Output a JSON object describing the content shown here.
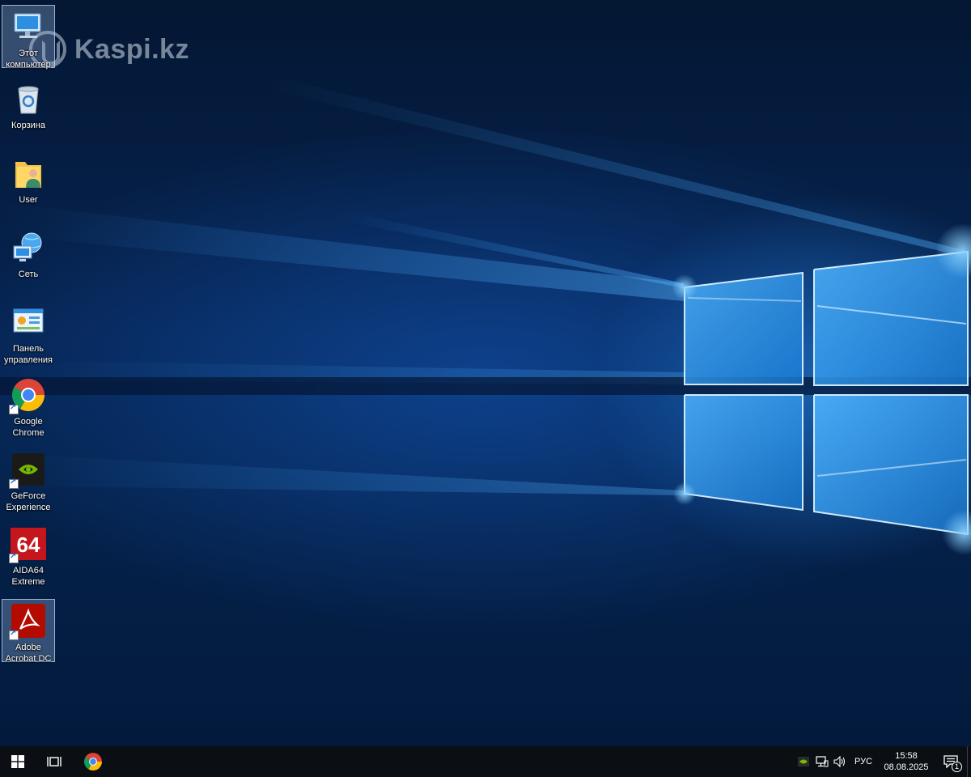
{
  "watermark": {
    "text": "Kaspi.kz"
  },
  "desktop_icons": [
    {
      "label": "Этот компьютер",
      "icon": "this-pc-icon",
      "selected": true
    },
    {
      "label": "Корзина",
      "icon": "recycle-bin-icon",
      "selected": false
    },
    {
      "label": "User",
      "icon": "user-folder-icon",
      "selected": false
    },
    {
      "label": "Сеть",
      "icon": "network-icon",
      "selected": false
    },
    {
      "label": "Панель управления",
      "icon": "control-panel-icon",
      "selected": false
    },
    {
      "label": "Google Chrome",
      "icon": "chrome-icon",
      "shortcut": true,
      "selected": false
    },
    {
      "label": "GeForce Experience",
      "icon": "nvidia-icon",
      "shortcut": true,
      "selected": false
    },
    {
      "label": "AIDA64 Extreme",
      "icon": "aida64-icon",
      "badge": "64",
      "shortcut": true,
      "selected": false
    },
    {
      "label": "Adobe Acrobat DC",
      "icon": "acrobat-icon",
      "shortcut": true,
      "selected": true
    }
  ],
  "taskbar": {
    "start": {
      "icon": "windows-start-icon"
    },
    "task_view": {
      "icon": "task-view-icon"
    },
    "pinned": [
      {
        "icon": "chrome-icon",
        "name": "Google Chrome"
      }
    ],
    "tray": {
      "nvidia": {
        "icon": "nvidia-tray-icon"
      },
      "network": {
        "icon": "network-tray-icon"
      },
      "volume": {
        "icon": "volume-icon"
      },
      "language": "РУС",
      "time": "15:58",
      "date": "08.08.2025",
      "notifications": {
        "icon": "action-center-icon",
        "count": "1"
      }
    }
  },
  "colors": {
    "taskbar": "#0b0f14",
    "wallpaper_dark": "#041733",
    "wallpaper_light": "#3aa0f0"
  }
}
